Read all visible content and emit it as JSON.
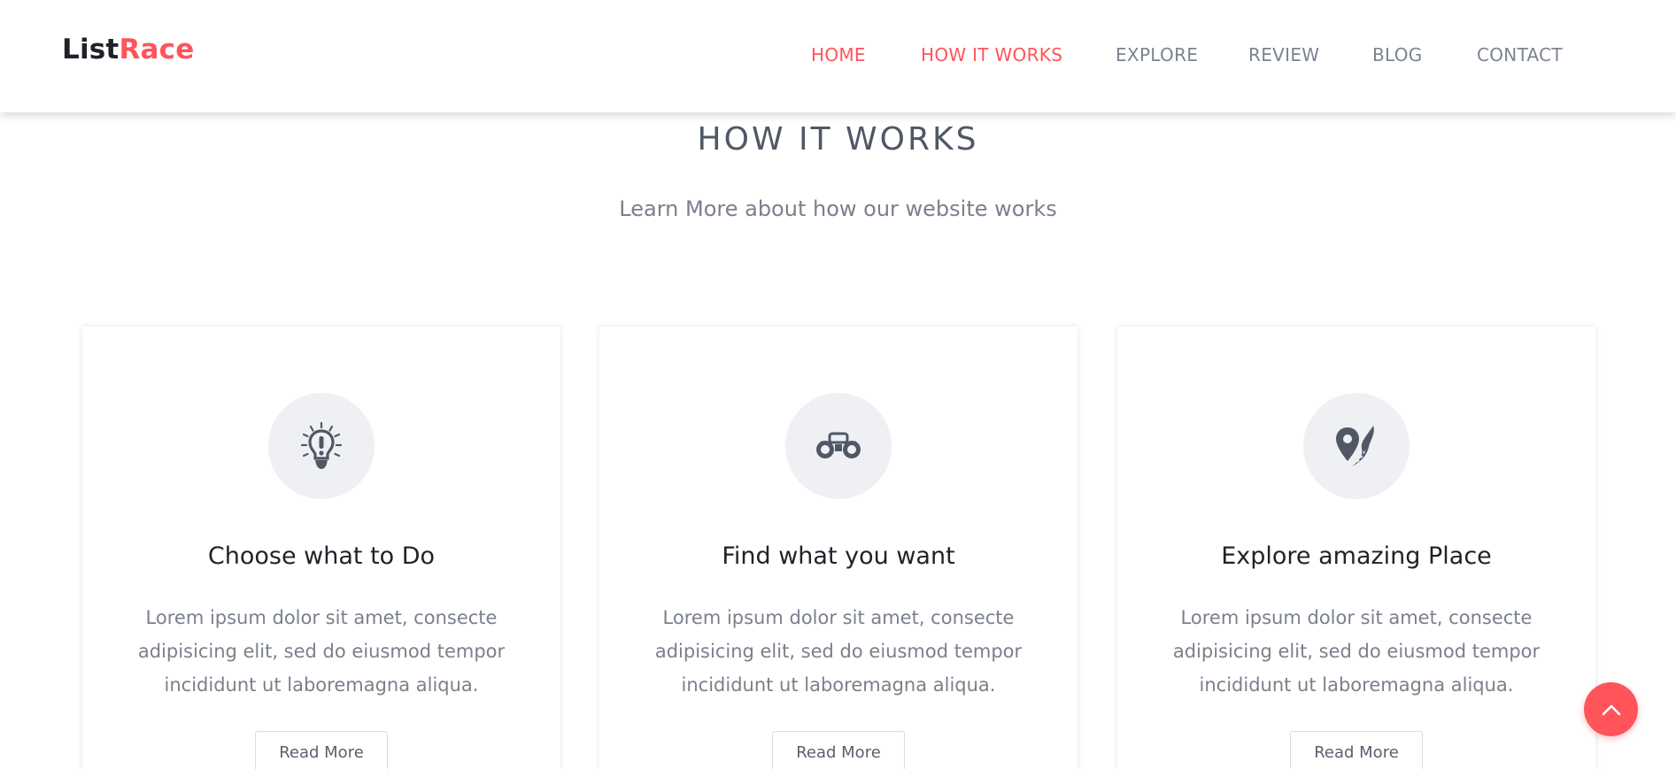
{
  "brand": {
    "logo_part1": "List",
    "logo_part2": "Race",
    "accent_color": "#ff545a"
  },
  "nav": {
    "items": [
      {
        "label": "HOME",
        "active": true
      },
      {
        "label": "HOW IT WORKS",
        "active": true
      },
      {
        "label": "EXPLORE",
        "active": false
      },
      {
        "label": "REVIEW",
        "active": false
      },
      {
        "label": "BLOG",
        "active": false
      },
      {
        "label": "CONTACT",
        "active": false
      }
    ]
  },
  "section": {
    "title": "HOW IT WORKS",
    "subtitle": "Learn More about how our website works"
  },
  "cards": [
    {
      "icon": "lightbulb-icon",
      "title": "Choose what to Do",
      "text": "Lorem ipsum dolor sit amet, consecte adipisicing elit, sed do eiusmod tempor incididunt ut laboremagna aliqua.",
      "button": "Read More"
    },
    {
      "icon": "binoculars-icon",
      "title": "Find what you want",
      "text": "Lorem ipsum dolor sit amet, consecte adipisicing elit, sed do eiusmod tempor incididunt ut laboremagna aliqua.",
      "button": "Read More"
    },
    {
      "icon": "map-pin-road-icon",
      "title": "Explore amazing Place",
      "text": "Lorem ipsum dolor sit amet, consecte adipisicing elit, sed do eiusmod tempor incididunt ut laboremagna aliqua.",
      "button": "Read More"
    }
  ],
  "scroll_top": {
    "icon": "chevron-up-icon"
  }
}
